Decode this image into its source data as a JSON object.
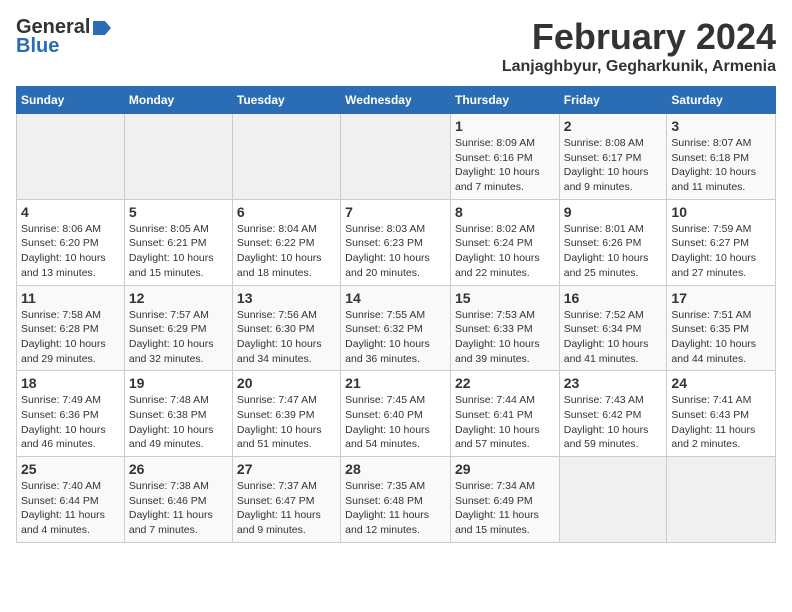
{
  "header": {
    "logo_general": "General",
    "logo_blue": "Blue",
    "month_title": "February 2024",
    "location": "Lanjaghbyur, Gegharkunik, Armenia"
  },
  "calendar": {
    "days_of_week": [
      "Sunday",
      "Monday",
      "Tuesday",
      "Wednesday",
      "Thursday",
      "Friday",
      "Saturday"
    ],
    "weeks": [
      [
        {
          "day": "",
          "detail": ""
        },
        {
          "day": "",
          "detail": ""
        },
        {
          "day": "",
          "detail": ""
        },
        {
          "day": "",
          "detail": ""
        },
        {
          "day": "1",
          "detail": "Sunrise: 8:09 AM\nSunset: 6:16 PM\nDaylight: 10 hours\nand 7 minutes."
        },
        {
          "day": "2",
          "detail": "Sunrise: 8:08 AM\nSunset: 6:17 PM\nDaylight: 10 hours\nand 9 minutes."
        },
        {
          "day": "3",
          "detail": "Sunrise: 8:07 AM\nSunset: 6:18 PM\nDaylight: 10 hours\nand 11 minutes."
        }
      ],
      [
        {
          "day": "4",
          "detail": "Sunrise: 8:06 AM\nSunset: 6:20 PM\nDaylight: 10 hours\nand 13 minutes."
        },
        {
          "day": "5",
          "detail": "Sunrise: 8:05 AM\nSunset: 6:21 PM\nDaylight: 10 hours\nand 15 minutes."
        },
        {
          "day": "6",
          "detail": "Sunrise: 8:04 AM\nSunset: 6:22 PM\nDaylight: 10 hours\nand 18 minutes."
        },
        {
          "day": "7",
          "detail": "Sunrise: 8:03 AM\nSunset: 6:23 PM\nDaylight: 10 hours\nand 20 minutes."
        },
        {
          "day": "8",
          "detail": "Sunrise: 8:02 AM\nSunset: 6:24 PM\nDaylight: 10 hours\nand 22 minutes."
        },
        {
          "day": "9",
          "detail": "Sunrise: 8:01 AM\nSunset: 6:26 PM\nDaylight: 10 hours\nand 25 minutes."
        },
        {
          "day": "10",
          "detail": "Sunrise: 7:59 AM\nSunset: 6:27 PM\nDaylight: 10 hours\nand 27 minutes."
        }
      ],
      [
        {
          "day": "11",
          "detail": "Sunrise: 7:58 AM\nSunset: 6:28 PM\nDaylight: 10 hours\nand 29 minutes."
        },
        {
          "day": "12",
          "detail": "Sunrise: 7:57 AM\nSunset: 6:29 PM\nDaylight: 10 hours\nand 32 minutes."
        },
        {
          "day": "13",
          "detail": "Sunrise: 7:56 AM\nSunset: 6:30 PM\nDaylight: 10 hours\nand 34 minutes."
        },
        {
          "day": "14",
          "detail": "Sunrise: 7:55 AM\nSunset: 6:32 PM\nDaylight: 10 hours\nand 36 minutes."
        },
        {
          "day": "15",
          "detail": "Sunrise: 7:53 AM\nSunset: 6:33 PM\nDaylight: 10 hours\nand 39 minutes."
        },
        {
          "day": "16",
          "detail": "Sunrise: 7:52 AM\nSunset: 6:34 PM\nDaylight: 10 hours\nand 41 minutes."
        },
        {
          "day": "17",
          "detail": "Sunrise: 7:51 AM\nSunset: 6:35 PM\nDaylight: 10 hours\nand 44 minutes."
        }
      ],
      [
        {
          "day": "18",
          "detail": "Sunrise: 7:49 AM\nSunset: 6:36 PM\nDaylight: 10 hours\nand 46 minutes."
        },
        {
          "day": "19",
          "detail": "Sunrise: 7:48 AM\nSunset: 6:38 PM\nDaylight: 10 hours\nand 49 minutes."
        },
        {
          "day": "20",
          "detail": "Sunrise: 7:47 AM\nSunset: 6:39 PM\nDaylight: 10 hours\nand 51 minutes."
        },
        {
          "day": "21",
          "detail": "Sunrise: 7:45 AM\nSunset: 6:40 PM\nDaylight: 10 hours\nand 54 minutes."
        },
        {
          "day": "22",
          "detail": "Sunrise: 7:44 AM\nSunset: 6:41 PM\nDaylight: 10 hours\nand 57 minutes."
        },
        {
          "day": "23",
          "detail": "Sunrise: 7:43 AM\nSunset: 6:42 PM\nDaylight: 10 hours\nand 59 minutes."
        },
        {
          "day": "24",
          "detail": "Sunrise: 7:41 AM\nSunset: 6:43 PM\nDaylight: 11 hours\nand 2 minutes."
        }
      ],
      [
        {
          "day": "25",
          "detail": "Sunrise: 7:40 AM\nSunset: 6:44 PM\nDaylight: 11 hours\nand 4 minutes."
        },
        {
          "day": "26",
          "detail": "Sunrise: 7:38 AM\nSunset: 6:46 PM\nDaylight: 11 hours\nand 7 minutes."
        },
        {
          "day": "27",
          "detail": "Sunrise: 7:37 AM\nSunset: 6:47 PM\nDaylight: 11 hours\nand 9 minutes."
        },
        {
          "day": "28",
          "detail": "Sunrise: 7:35 AM\nSunset: 6:48 PM\nDaylight: 11 hours\nand 12 minutes."
        },
        {
          "day": "29",
          "detail": "Sunrise: 7:34 AM\nSunset: 6:49 PM\nDaylight: 11 hours\nand 15 minutes."
        },
        {
          "day": "",
          "detail": ""
        },
        {
          "day": "",
          "detail": ""
        }
      ]
    ]
  }
}
